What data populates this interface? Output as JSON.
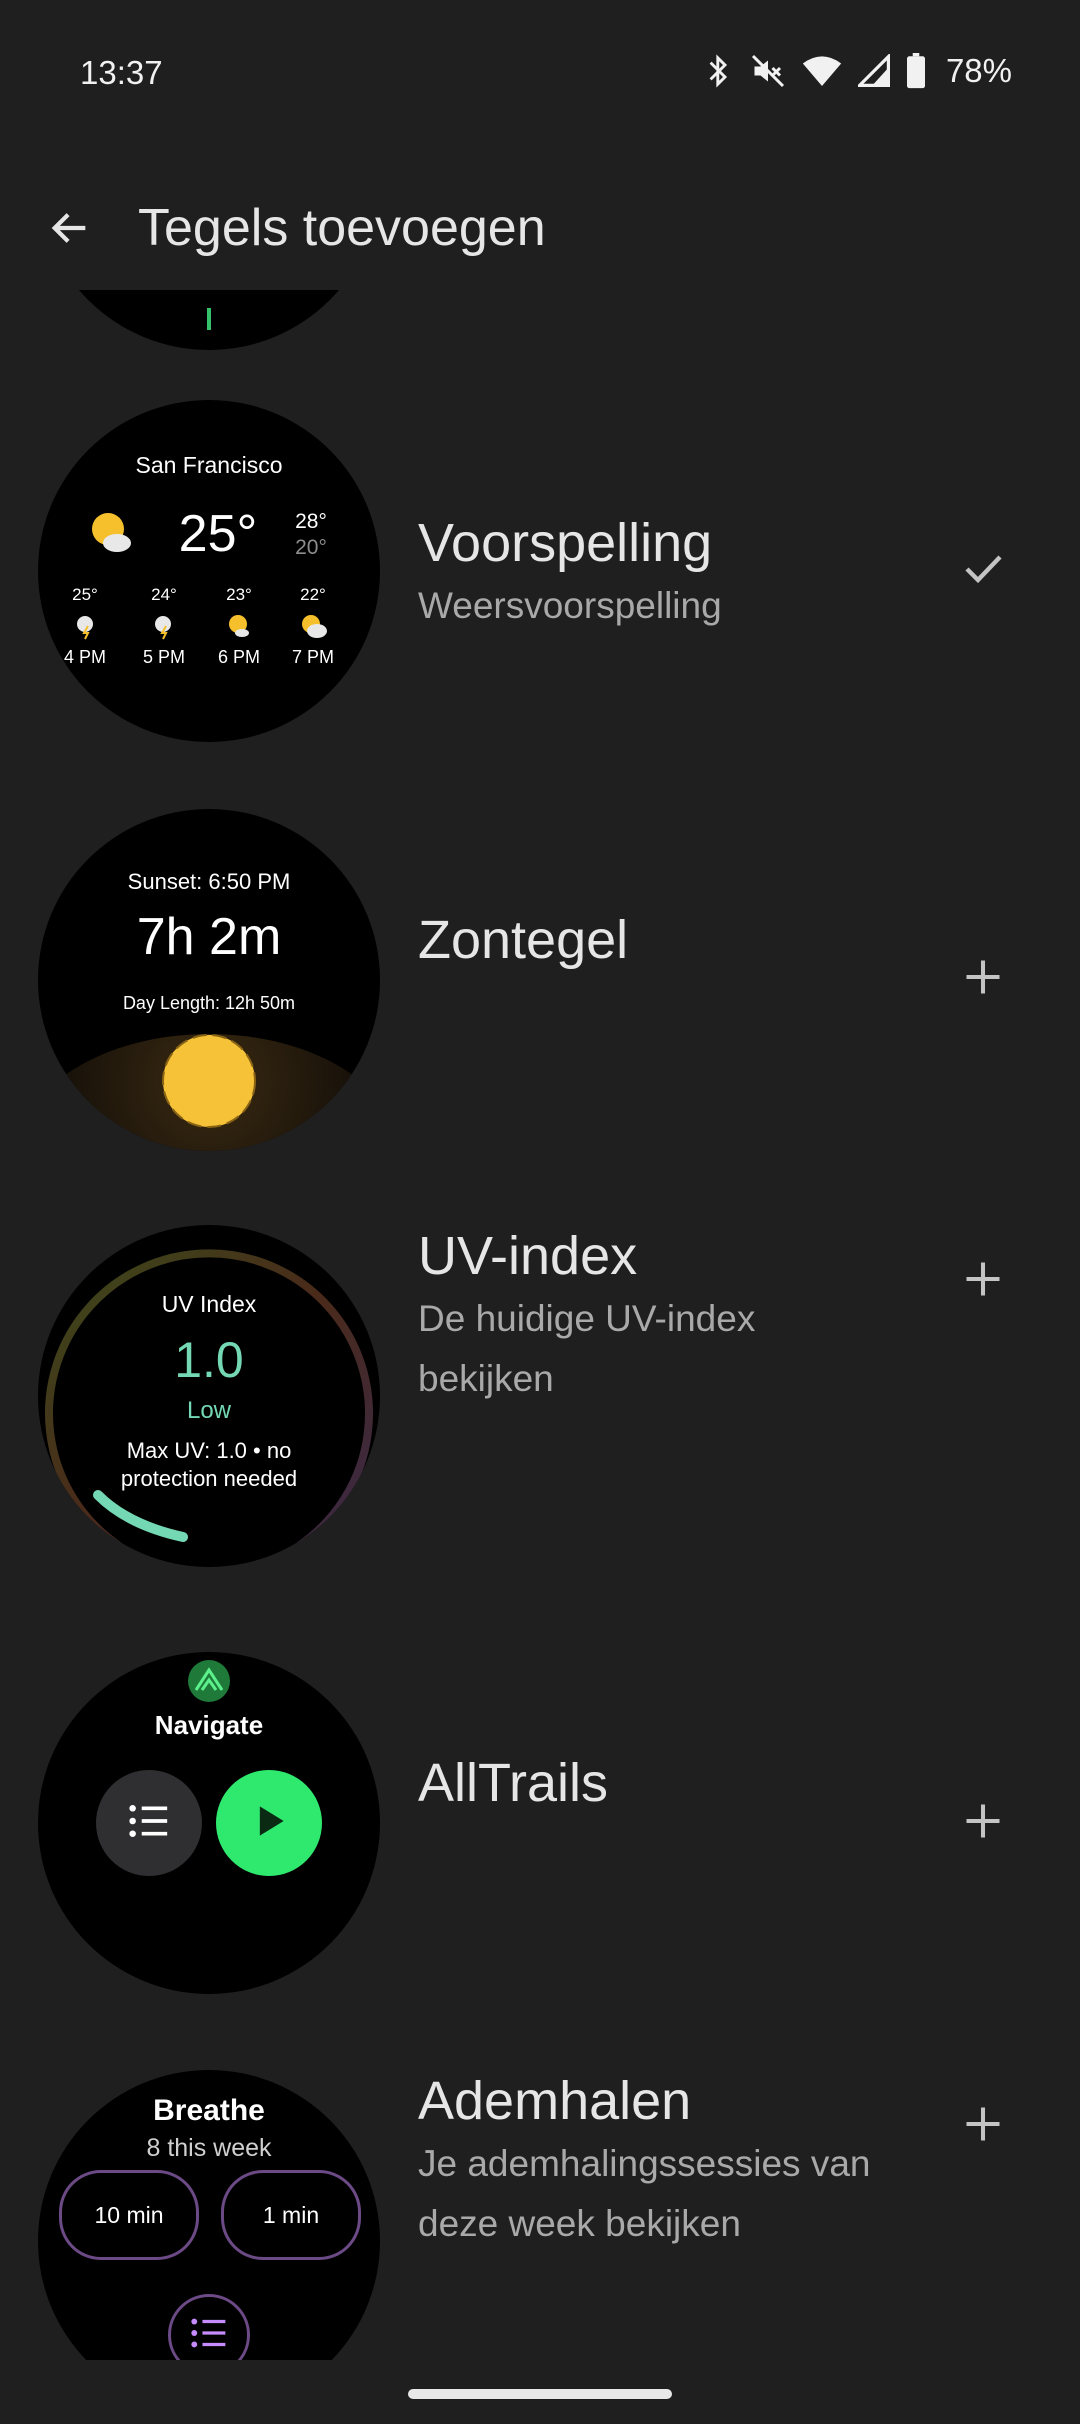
{
  "status": {
    "time": "13:37",
    "battery": "78%"
  },
  "app_bar": {
    "title": "Tegels toevoegen"
  },
  "tiles": [
    {
      "title": "Voorspelling",
      "subtitle": "Weersvoorspelling",
      "action": "check-icon",
      "preview": {
        "city": "San Francisco",
        "temp": "25°",
        "high": "28°",
        "low": "20°",
        "hours": [
          {
            "temp": "25°",
            "time": "4 PM"
          },
          {
            "temp": "24°",
            "time": "5 PM"
          },
          {
            "temp": "23°",
            "time": "6 PM"
          },
          {
            "temp": "22°",
            "time": "7 PM"
          }
        ]
      }
    },
    {
      "title": "Zontegel",
      "subtitle": "",
      "action": "plus-icon",
      "preview": {
        "sunset": "Sunset: 6:50 PM",
        "main": "7h 2m",
        "day_length": "Day Length: 12h 50m"
      }
    },
    {
      "title": "UV-index",
      "subtitle": "De huidige UV-index bekijken",
      "action": "plus-icon",
      "preview": {
        "label": "UV Index",
        "value": "1.0",
        "level": "Low",
        "note": "Max UV: 1.0 • no protection needed"
      }
    },
    {
      "title": "AllTrails",
      "subtitle": "",
      "action": "plus-icon",
      "preview": {
        "label": "Navigate"
      }
    },
    {
      "title": "Ademhalen",
      "subtitle": "Je ademhalingssessies van deze week bekijken",
      "action": "plus-icon",
      "preview": {
        "label": "Breathe",
        "count": "8 this week",
        "btn1": "10 min",
        "btn2": "1 min"
      }
    }
  ]
}
